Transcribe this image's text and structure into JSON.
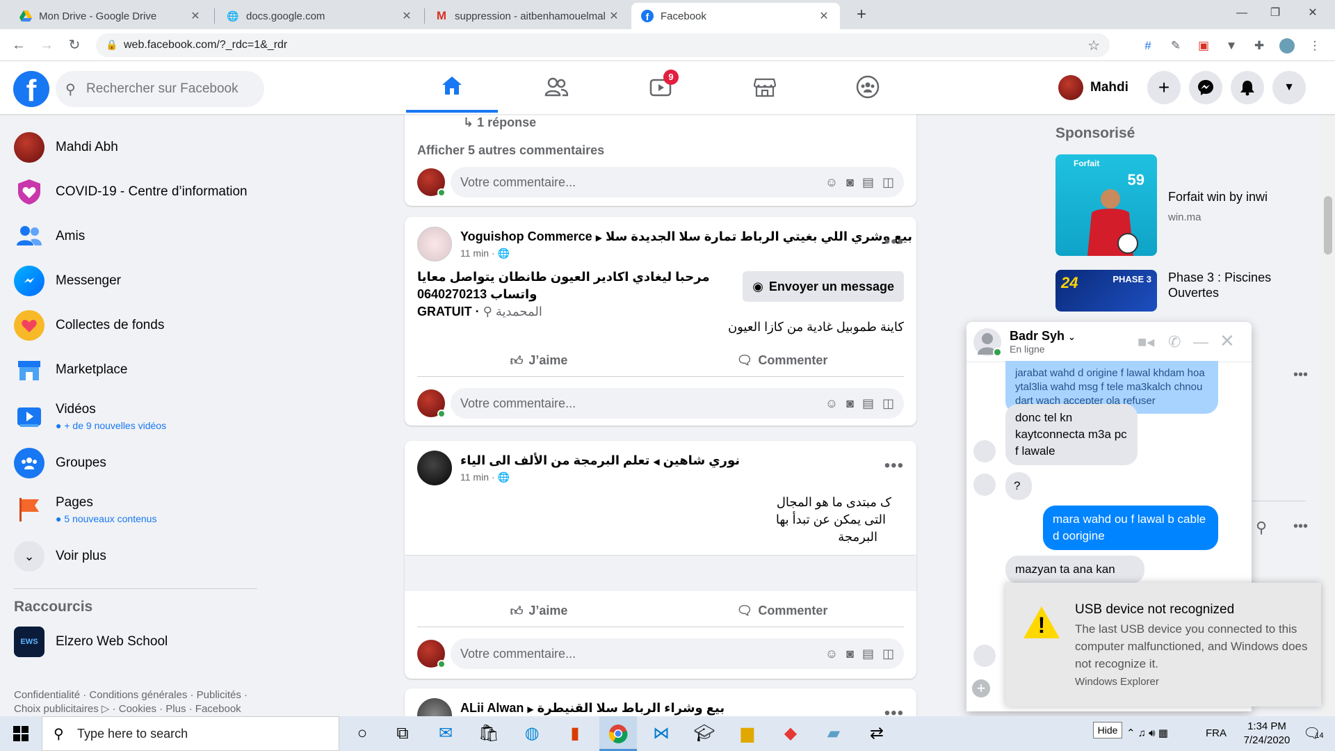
{
  "browser": {
    "tabs": [
      {
        "title": "Mon Drive - Google Drive",
        "icon": "google-drive-icon"
      },
      {
        "title": "docs.google.com",
        "icon": "globe-icon"
      },
      {
        "title": "suppression - aitbenhamouelmal",
        "icon": "gmail-icon"
      },
      {
        "title": "Facebook",
        "icon": "facebook-icon"
      }
    ],
    "url": "web.facebook.com/?_rdc=1&_rdr"
  },
  "fb_header": {
    "search_placeholder": "Rechercher sur Facebook",
    "watch_badge": "9",
    "profile_name": "Mahdi"
  },
  "left_nav": {
    "items": [
      {
        "label": "Mahdi Abh",
        "sub": ""
      },
      {
        "label": "COVID-19 - Centre d’information",
        "sub": ""
      },
      {
        "label": "Amis",
        "sub": ""
      },
      {
        "label": "Messenger",
        "sub": ""
      },
      {
        "label": "Collectes de fonds",
        "sub": ""
      },
      {
        "label": "Marketplace",
        "sub": ""
      },
      {
        "label": "Vidéos",
        "sub": "+ de 9 nouvelles vidéos"
      },
      {
        "label": "Groupes",
        "sub": ""
      },
      {
        "label": "Pages",
        "sub": "5 nouveaux contenus"
      },
      {
        "label": "Voir plus",
        "sub": ""
      }
    ],
    "shortcuts_title": "Raccourcis",
    "shortcuts": [
      {
        "label": "Elzero Web School"
      }
    ],
    "footer_line1": "Confidentialité · Conditions générales · Publicités ·",
    "footer_line2": "Choix publicitaires ▷ · Cookies · Plus · Facebook"
  },
  "feed": {
    "top_card": {
      "reply_link": "1 réponse",
      "more_comments": "Afficher 5 autres commentaires"
    },
    "comment_placeholder": "Votre commentaire...",
    "like_label": "J’aime",
    "comment_label": "Commenter",
    "post1": {
      "author": "Yoguishop Commerce",
      "group": "بيع وشري اللي بغيتي الرباط تمارة سلا الجديدة سلا",
      "time": "11 min ·",
      "line1": "مرحبا ليغادي اكادير العيون طانطان يتواصل معايا",
      "line2": "واتساب 0640270213",
      "price": "GRATUIT ·",
      "location": "المحمدية",
      "title": "كاينة طموبيل غادية من كازا العيون",
      "message_button": "Envoyer un message"
    },
    "post2": {
      "author": "نوري شاهين",
      "group": "تعلم البرمجة من الألف الى الياء",
      "time": "11 min ·",
      "lines": [
        "ک مبتدی ما هو المجال",
        "التى يمكن عن تبدأ بها",
        "البرمجة"
      ]
    },
    "post3": {
      "author": "ALii Alwan",
      "group": "بيع وشراء الرباط سلا القنيطرة"
    }
  },
  "right_rail": {
    "sponsored_title": "Sponsorisé",
    "ads": [
      {
        "name": "Forfait win by inwi",
        "url": "win.ma",
        "img_text1": "Forfait",
        "img_text2": "59"
      },
      {
        "name": "Phase 3 : Piscines Ouvertes",
        "url": "",
        "img_text1": "24",
        "img_text2": "PHASE 3"
      }
    ]
  },
  "chat": {
    "name": "Badr Syh",
    "status": "En ligne",
    "messages": [
      {
        "dir": "out",
        "text": "jarabat wahd d origine f lawal khdam hoa ytal3lia wahd msg f tele ma3kalch chnou dart wach accepter ola refuser"
      },
      {
        "dir": "in",
        "text": "donc tel kn kaytconnecta m3a pc f lawale"
      },
      {
        "dir": "in",
        "text": "?"
      },
      {
        "dir": "out",
        "text": "mara wahd ou f lawal b cable d oorigine"
      },
      {
        "dir": "in",
        "text": "mazyan ta ana kan"
      }
    ]
  },
  "notification": {
    "title": "USB device not recognized",
    "body": "The last USB device you connected to this computer malfunctioned, and Windows does not recognize it.",
    "source": "Windows Explorer",
    "hide_label": "Hide"
  },
  "taskbar": {
    "search_placeholder": "Type here to search",
    "language": "FRA",
    "time": "1:34 PM",
    "date": "7/24/2020",
    "notif_count": "14"
  }
}
